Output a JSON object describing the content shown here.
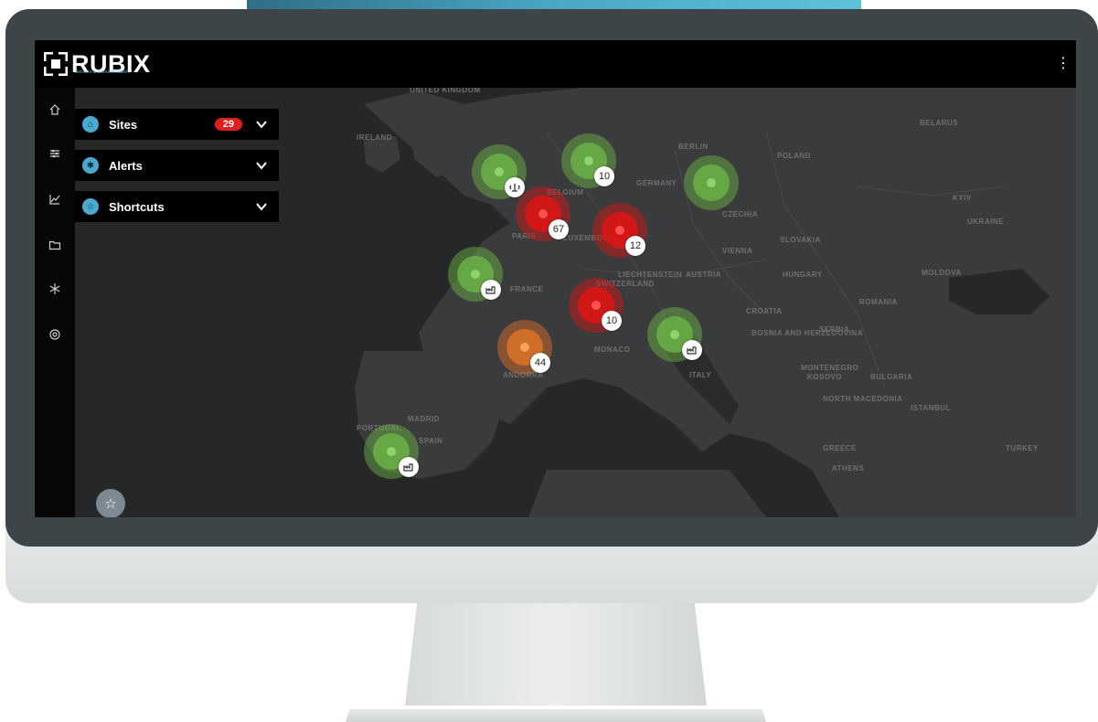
{
  "app": {
    "name": "RUBIX",
    "tagline": "Sensors & Instrumentation"
  },
  "header": {
    "menu_icon": "kebab-menu-icon"
  },
  "sidebar": {
    "items": [
      {
        "icon": "home-icon"
      },
      {
        "icon": "sliders-icon"
      },
      {
        "icon": "line-chart-icon"
      },
      {
        "icon": "folder-icon"
      },
      {
        "icon": "snowflake-icon"
      },
      {
        "icon": "settings-icon"
      }
    ]
  },
  "panel": {
    "items": [
      {
        "label": "Sites",
        "badge": "29",
        "icon": "sites-icon"
      },
      {
        "label": "Alerts",
        "icon": "alerts-icon"
      },
      {
        "label": "Shortcuts",
        "icon": "star-icon"
      }
    ]
  },
  "fab": {
    "icon": "star-icon"
  },
  "map": {
    "labels": [
      "UNITED KINGDOM",
      "IRELAND",
      "BELGIUM",
      "LUXEMBOURG",
      "GERMANY",
      "BERLIN",
      "POLAND",
      "CZECHIA",
      "SLOVAKIA",
      "UKRAINE",
      "BELARUS",
      "VIENNA",
      "HUNGARY",
      "AUSTRIA",
      "LIECHTENSTEIN",
      "SWITZERLAND",
      "FRANCE",
      "PARIS",
      "CROATIA",
      "ROMANIA",
      "MOLDOVA",
      "BOSNIA AND HERZEGOVINA",
      "SERBIA",
      "MONTENEGRO",
      "KOSOVO",
      "BULGARIA",
      "NORTH MACEDONIA",
      "ITALY",
      "MONACO",
      "ANDORRA",
      "SPAIN",
      "MADRID",
      "PORTUGAL",
      "GREECE",
      "ATHENS",
      "ISTANBUL",
      "TURKEY",
      "KYIV"
    ],
    "markers": [
      {
        "status": "green",
        "count": null,
        "badge_icon": "signal-tower-icon"
      },
      {
        "status": "green",
        "count": "10",
        "badge_icon": null
      },
      {
        "status": "green",
        "count": null,
        "badge_icon": null
      },
      {
        "status": "red",
        "count": "67",
        "badge_icon": null
      },
      {
        "status": "red",
        "count": "12",
        "badge_icon": null
      },
      {
        "status": "green",
        "count": null,
        "badge_icon": "factory-icon"
      },
      {
        "status": "red",
        "count": "10",
        "badge_icon": null
      },
      {
        "status": "green",
        "count": null,
        "badge_icon": "factory-icon"
      },
      {
        "status": "orange",
        "count": "44",
        "badge_icon": null
      },
      {
        "status": "green",
        "count": null,
        "badge_icon": "factory-icon"
      }
    ]
  },
  "colors": {
    "accent": "#4aa9cf",
    "alert_red": "#e01d1d",
    "ok_green": "#6eba48",
    "warn_orange": "#dc7328"
  }
}
